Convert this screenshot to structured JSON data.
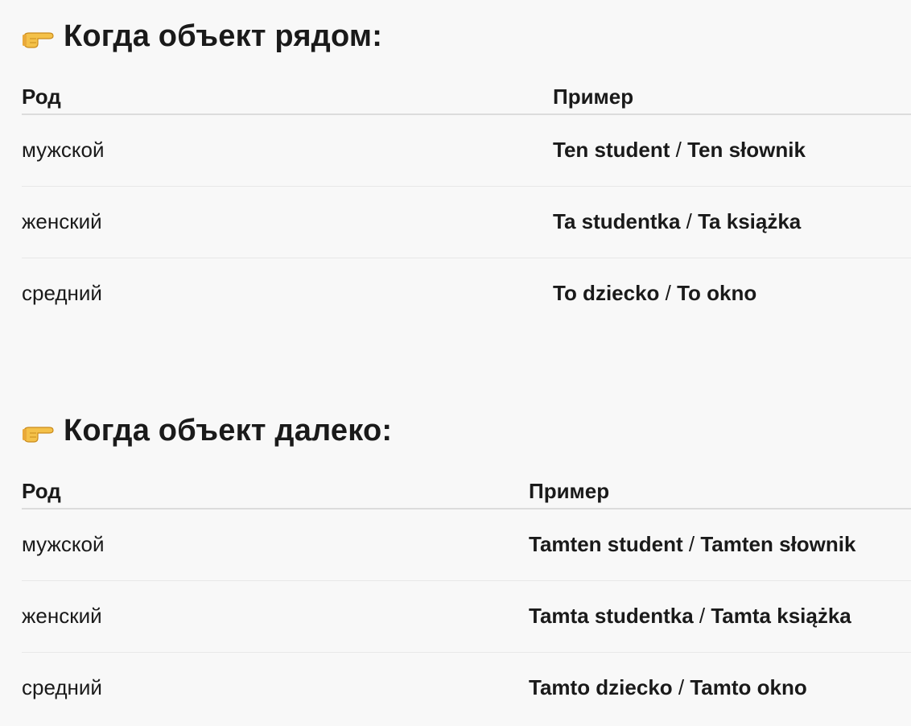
{
  "sections": [
    {
      "title": "Когда объект рядом:",
      "headers": {
        "gender": "Род",
        "example": "Пример"
      },
      "rows": [
        {
          "gender": "мужской",
          "ex1": "Ten student",
          "sep": " / ",
          "ex2": "Ten słownik"
        },
        {
          "gender": "женский",
          "ex1": "Ta studentka",
          "sep": " / ",
          "ex2": "Ta książka"
        },
        {
          "gender": "средний",
          "ex1": "To dziecko",
          "sep": " / ",
          "ex2": "To okno"
        }
      ]
    },
    {
      "title": "Когда объект далеко:",
      "headers": {
        "gender": "Род",
        "example": "Пример"
      },
      "rows": [
        {
          "gender": "мужской",
          "ex1": "Tamten student",
          "sep": " / ",
          "ex2": "Tamten słownik"
        },
        {
          "gender": "женский",
          "ex1": "Tamta studentka",
          "sep": " / ",
          "ex2": "Tamta książka"
        },
        {
          "gender": "средний",
          "ex1": "Tamto dziecko",
          "sep": " / ",
          "ex2": "Tamto okno"
        }
      ]
    }
  ],
  "icons": {
    "heading_icon": "pointing-hand-icon"
  },
  "colors": {
    "background": "#f8f8f8",
    "text": "#1a1a1a",
    "divider": "#dcdcdc"
  }
}
